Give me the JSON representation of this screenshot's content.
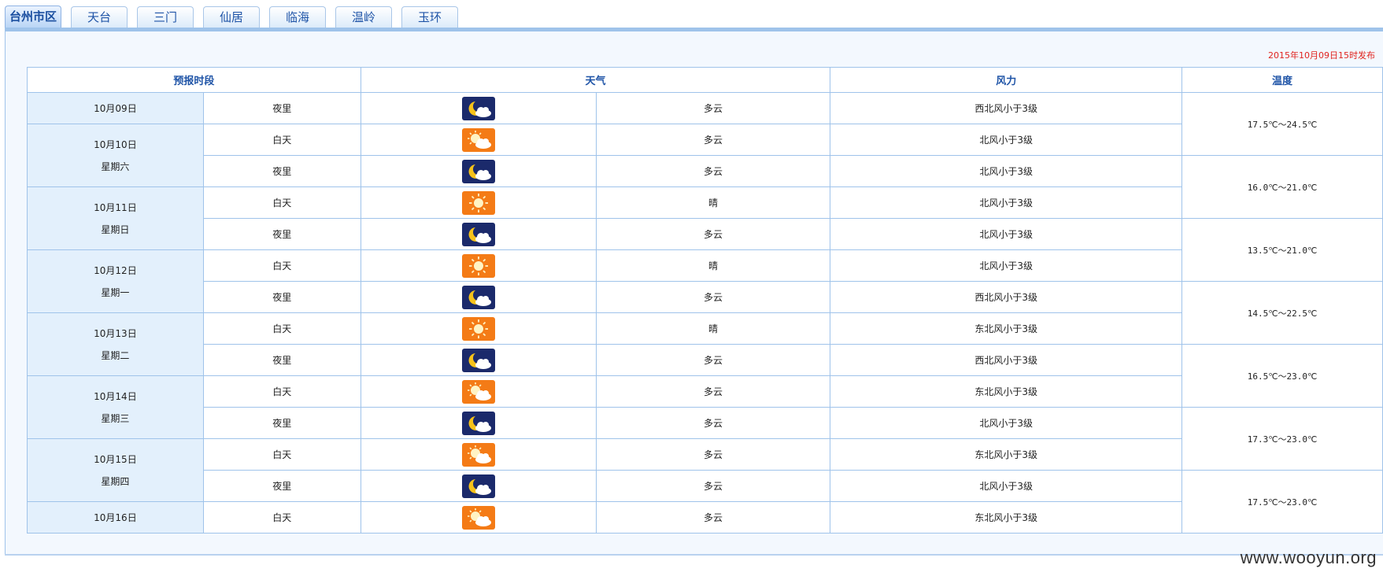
{
  "tabs": [
    {
      "label": "台州市区",
      "active": true
    },
    {
      "label": "天台",
      "active": false
    },
    {
      "label": "三门",
      "active": false
    },
    {
      "label": "仙居",
      "active": false
    },
    {
      "label": "临海",
      "active": false
    },
    {
      "label": "温岭",
      "active": false
    },
    {
      "label": "玉环",
      "active": false
    }
  ],
  "publish_time": "2015年10月09日15时发布",
  "table": {
    "headers": {
      "period": "预报时段",
      "weather": "天气",
      "wind": "风力",
      "temp": "温度"
    },
    "dates": [
      {
        "date": "10月09日",
        "weekday": ""
      },
      {
        "date": "10月10日",
        "weekday": "星期六"
      },
      {
        "date": "10月11日",
        "weekday": "星期日"
      },
      {
        "date": "10月12日",
        "weekday": "星期一"
      },
      {
        "date": "10月13日",
        "weekday": "星期二"
      },
      {
        "date": "10月14日",
        "weekday": "星期三"
      },
      {
        "date": "10月15日",
        "weekday": "星期四"
      },
      {
        "date": "10月16日",
        "weekday": ""
      }
    ],
    "rows": [
      {
        "period": "夜里",
        "icon": "night-cloudy-icon",
        "weather": "多云",
        "wind": "西北风小于3级"
      },
      {
        "period": "白天",
        "icon": "day-cloudy-icon",
        "weather": "多云",
        "wind": "北风小于3级"
      },
      {
        "period": "夜里",
        "icon": "night-cloudy-icon",
        "weather": "多云",
        "wind": "北风小于3级"
      },
      {
        "period": "白天",
        "icon": "sunny-icon",
        "weather": "晴",
        "wind": "北风小于3级"
      },
      {
        "period": "夜里",
        "icon": "night-cloudy-icon",
        "weather": "多云",
        "wind": "北风小于3级"
      },
      {
        "period": "白天",
        "icon": "sunny-icon",
        "weather": "晴",
        "wind": "北风小于3级"
      },
      {
        "period": "夜里",
        "icon": "night-cloudy-icon",
        "weather": "多云",
        "wind": "西北风小于3级"
      },
      {
        "period": "白天",
        "icon": "sunny-icon",
        "weather": "晴",
        "wind": "东北风小于3级"
      },
      {
        "period": "夜里",
        "icon": "night-cloudy-icon",
        "weather": "多云",
        "wind": "西北风小于3级"
      },
      {
        "period": "白天",
        "icon": "day-cloudy-icon",
        "weather": "多云",
        "wind": "东北风小于3级"
      },
      {
        "period": "夜里",
        "icon": "night-cloudy-icon",
        "weather": "多云",
        "wind": "北风小于3级"
      },
      {
        "period": "白天",
        "icon": "day-cloudy-icon",
        "weather": "多云",
        "wind": "东北风小于3级"
      },
      {
        "period": "夜里",
        "icon": "night-cloudy-icon",
        "weather": "多云",
        "wind": "北风小于3级"
      },
      {
        "period": "白天",
        "icon": "day-cloudy-icon",
        "weather": "多云",
        "wind": "东北风小于3级"
      }
    ],
    "temps": [
      "17.5℃～24.5℃",
      "16.0℃～21.0℃",
      "13.5℃～21.0℃",
      "14.5℃～22.5℃",
      "16.5℃～23.0℃",
      "17.3℃～23.0℃",
      "17.5℃～23.0℃"
    ]
  },
  "colors": {
    "night_icon_bg": "#1b2a6b",
    "day_icon_bg": "#f47b16",
    "publish_text": "#e0241e",
    "header_text": "#1f54a7",
    "border": "#9fc3ea",
    "date_cell_bg": "#e3f0fc"
  },
  "watermark": "www.wooyun.org"
}
